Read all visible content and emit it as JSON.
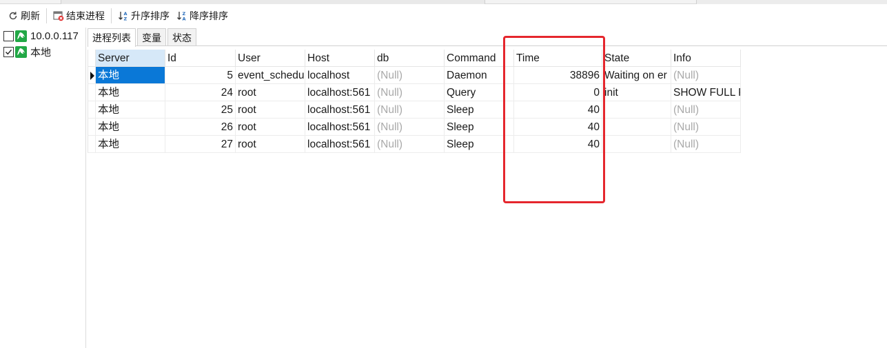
{
  "toolbar": {
    "refresh_label": "刷新",
    "kill_label": "结束进程",
    "sort_asc_label": "升序排序",
    "sort_desc_label": "降序排序"
  },
  "tree": [
    {
      "label": "10.0.0.117",
      "checked": false
    },
    {
      "label": "本地",
      "checked": true
    }
  ],
  "tabs": [
    {
      "label": "进程列表",
      "active": true
    },
    {
      "label": "变量",
      "active": false
    },
    {
      "label": "状态",
      "active": false
    }
  ],
  "grid": {
    "columns": [
      "Server",
      "Id",
      "User",
      "Host",
      "db",
      "Command",
      "Time",
      "State",
      "Info"
    ],
    "rows": [
      {
        "server": "本地",
        "id": "5",
        "user": "event_schedu",
        "host": "localhost",
        "db": "(Null)",
        "command": "Daemon",
        "time": "38896",
        "state": "Waiting on er",
        "info": "(Null)"
      },
      {
        "server": "本地",
        "id": "24",
        "user": "root",
        "host": "localhost:561",
        "db": "(Null)",
        "command": "Query",
        "time": "0",
        "state": "init",
        "info": "SHOW FULL P"
      },
      {
        "server": "本地",
        "id": "25",
        "user": "root",
        "host": "localhost:561",
        "db": "(Null)",
        "command": "Sleep",
        "time": "40",
        "state": "",
        "info": "(Null)"
      },
      {
        "server": "本地",
        "id": "26",
        "user": "root",
        "host": "localhost:561",
        "db": "(Null)",
        "command": "Sleep",
        "time": "40",
        "state": "",
        "info": "(Null)"
      },
      {
        "server": "本地",
        "id": "27",
        "user": "root",
        "host": "localhost:561",
        "db": "(Null)",
        "command": "Sleep",
        "time": "40",
        "state": "",
        "info": "(Null)"
      }
    ]
  },
  "colors": {
    "selection": "#0a78d7",
    "header_active": "#d6e8f8",
    "null_text": "#a9a9a9",
    "highlight_box": "#e5262d",
    "server_icon": "#22a846"
  },
  "icons": {
    "refresh": "refresh-icon",
    "kill": "kill-process-icon",
    "sort_asc": "sort-ascending-icon",
    "sort_desc": "sort-descending-icon",
    "server": "mysql-server-icon"
  }
}
